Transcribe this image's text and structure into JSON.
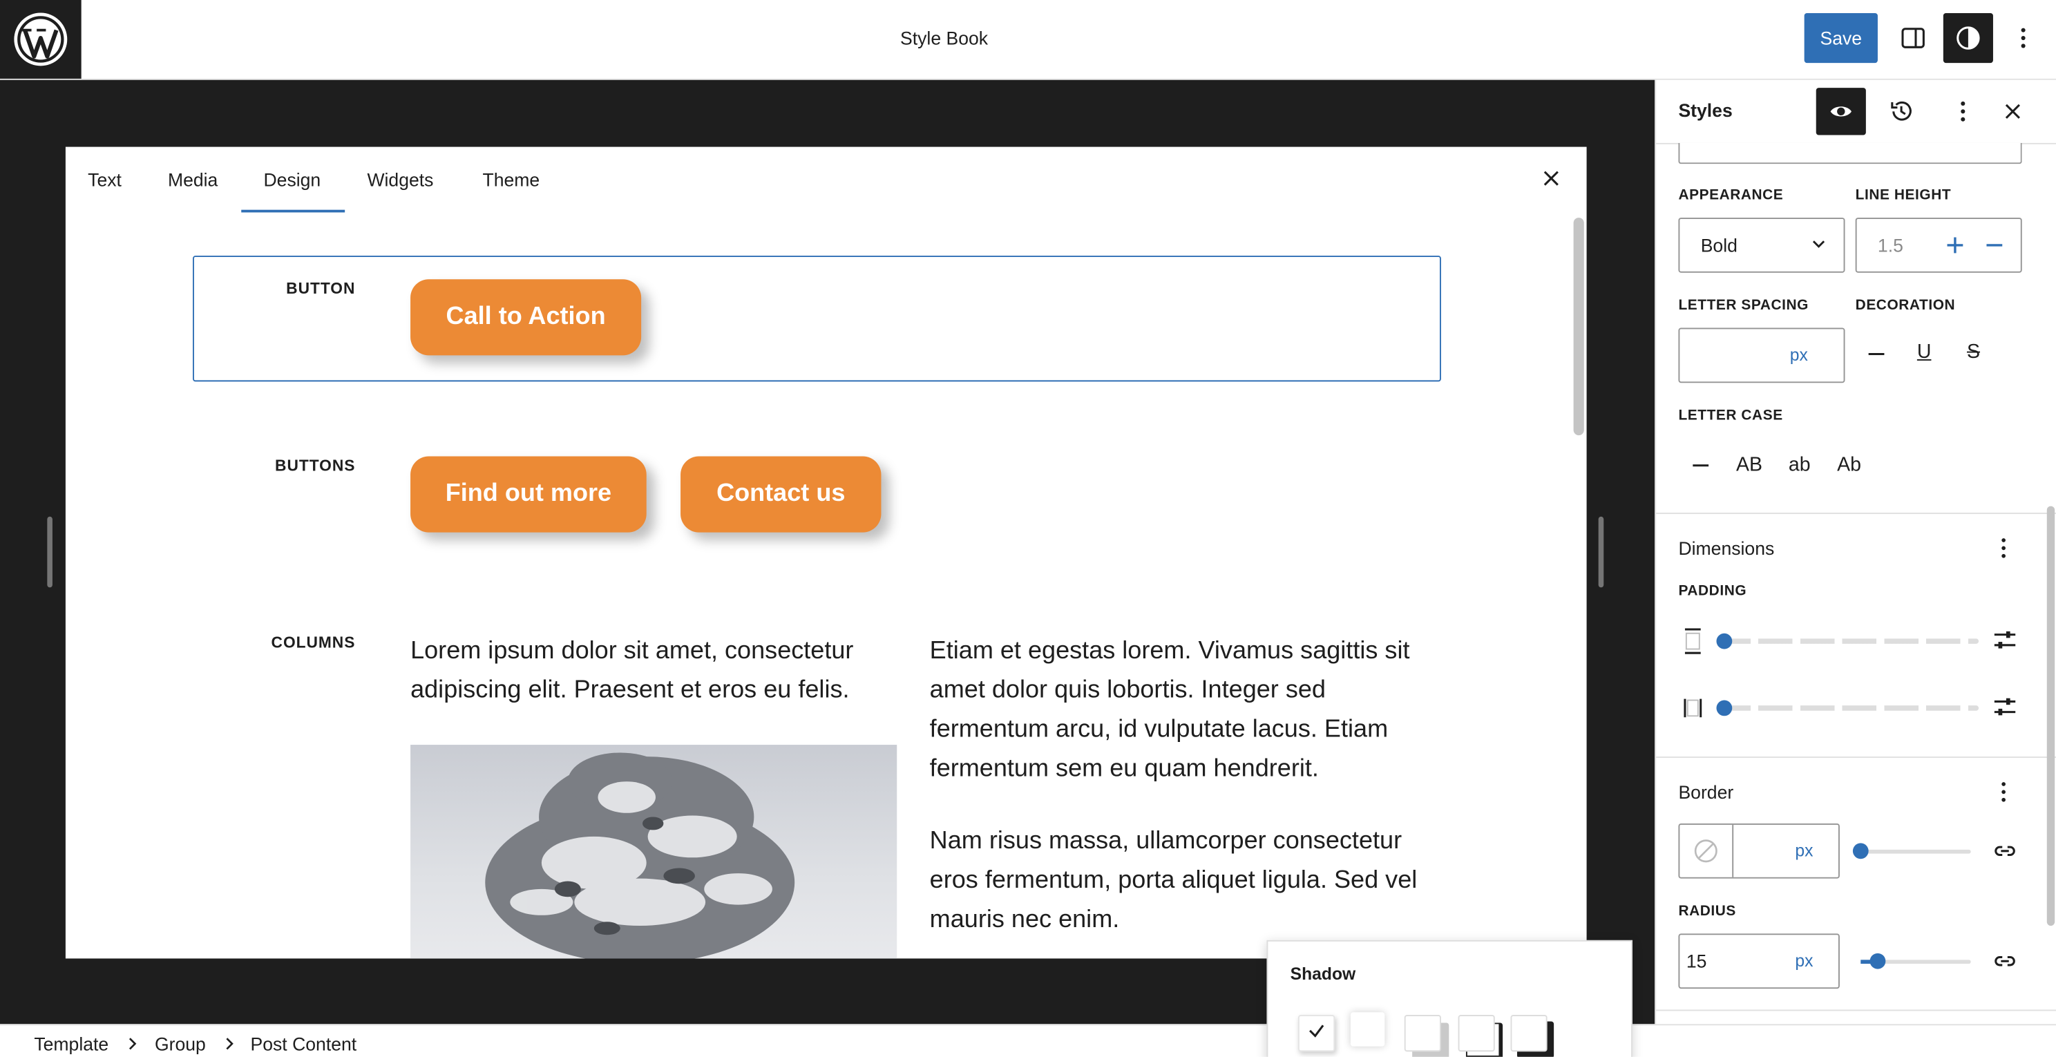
{
  "app": {
    "title": "Style Book",
    "save_label": "Save"
  },
  "preview": {
    "tabs": [
      "Text",
      "Media",
      "Design",
      "Widgets",
      "Theme"
    ],
    "active_tab": "Design",
    "sections": {
      "button_label": "BUTTON",
      "buttons_label": "BUTTONS",
      "columns_label": "COLUMNS"
    },
    "buttons": {
      "cta": "Call to Action",
      "find_out_more": "Find out more",
      "contact_us": "Contact us"
    },
    "columns": {
      "left_text": "Lorem ipsum dolor sit amet, consectetur adipiscing elit. Praesent et eros eu felis.",
      "right_text_1": "Etiam et egestas lorem. Vivamus sagittis sit amet dolor quis lobortis. Integer sed fermentum arcu, id vulputate lacus. Etiam fermentum sem eu quam hendrerit.",
      "right_text_2": "Nam risus massa, ullamcorper consectetur eros fermentum, porta aliquet ligula. Sed vel mauris nec enim."
    }
  },
  "sidebar": {
    "title": "Styles",
    "typography": {
      "appearance_label": "APPEARANCE",
      "appearance_value": "Bold",
      "line_height_label": "LINE HEIGHT",
      "line_height_placeholder": "1.5",
      "letter_spacing_label": "LETTER SPACING",
      "letter_spacing_unit": "px",
      "decoration_label": "DECORATION",
      "decoration_underline": "U",
      "decoration_strike": "S",
      "letter_case_label": "LETTER CASE",
      "case_upper": "AB",
      "case_lower": "ab",
      "case_capitalize": "Ab"
    },
    "dimensions": {
      "title": "Dimensions",
      "padding_label": "PADDING"
    },
    "border": {
      "title": "Border",
      "width_unit": "px",
      "radius_label": "RADIUS",
      "radius_value": "15",
      "radius_unit": "px"
    }
  },
  "shadow_popover": {
    "title": "Shadow"
  },
  "breadcrumb": [
    "Template",
    "Group",
    "Post Content"
  ],
  "colors": {
    "accent": "#2f6fb5",
    "button_orange": "#ec8a35",
    "canvas_bg": "#1e1e1e"
  }
}
